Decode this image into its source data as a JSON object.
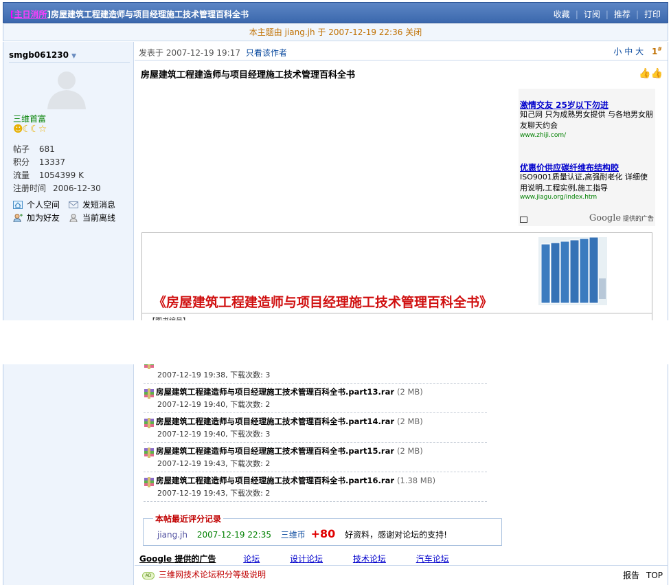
{
  "thread": {
    "tag_open": "[",
    "tag": "主日消所",
    "tag_close": "]",
    "title": "房屋建筑工程建造师与项目经理施工技术管理百科全书",
    "actions": [
      "收藏",
      "订阅",
      "推荐",
      "打印"
    ]
  },
  "closed_notice": "本主题由 jiang.jh 于  2007-12-19 22:36 关闭",
  "user": {
    "name": "smgb061230",
    "group": "三维首富",
    "stats": [
      {
        "key": "帖子",
        "val": "681"
      },
      {
        "key": "积分",
        "val": "13337"
      },
      {
        "key": "流量",
        "val": "1054399 K"
      },
      {
        "key": "注册时间",
        "val": "2006-12-30"
      }
    ],
    "actions": [
      "个人空间",
      "发短消息",
      "加为好友",
      "当前离线"
    ]
  },
  "post": {
    "posted_prefix": "发表于",
    "posted_at": "2007-12-19 19:17",
    "only_author": "只看该作者",
    "font_sizes": [
      "小",
      "中",
      "大"
    ],
    "floor": "1",
    "floor_mark": "#",
    "title": "房屋建筑工程建造师与项目经理施工技术管理百科全书",
    "book_title": "《房屋建筑工程建造师与项目经理施工技术管理百科全书》",
    "cut_text": "【图书编号】"
  },
  "ads": [
    {
      "title": "激情交友  25岁以下勿进",
      "desc": "知己网 只为成熟男女提供 与各地男女朋友聊天约会",
      "url": "www.zhiji.com/"
    },
    {
      "title": "优惠价供应碳纤维布结构胶",
      "desc": "ISO9001质量认证,高强耐老化 详细使用说明,工程实例,施工指导",
      "url": "www.jiagu.org/index.htm"
    }
  ],
  "ads_footer_brand": "Google",
  "ads_footer_text": "提供的广告",
  "attachments": [
    {
      "name": "",
      "size": "",
      "meta": "2007-12-19 19:38, 下载次数: 3"
    },
    {
      "name": "房屋建筑工程建造师与项目经理施工技术管理百科全书.part13.rar",
      "size": "(2 MB)",
      "meta": "2007-12-19 19:40, 下载次数: 2"
    },
    {
      "name": "房屋建筑工程建造师与项目经理施工技术管理百科全书.part14.rar",
      "size": "(2 MB)",
      "meta": "2007-12-19 19:40, 下载次数: 3"
    },
    {
      "name": "房屋建筑工程建造师与项目经理施工技术管理百科全书.part15.rar",
      "size": "(2 MB)",
      "meta": "2007-12-19 19:43, 下载次数: 2"
    },
    {
      "name": "房屋建筑工程建造师与项目经理施工技术管理百科全书.part16.rar",
      "size": "(1.38 MB)",
      "meta": "2007-12-19 19:43, 下载次数: 2"
    }
  ],
  "rating": {
    "caption": "本帖最近评分记录",
    "user": "jiang.jh",
    "date": "2007-12-19 22:35",
    "currency": "三维币",
    "points": "+80",
    "reason": "好资料，感谢对论坛的支持!"
  },
  "google_links": {
    "header": "Google 提供的广告",
    "links": [
      "论坛",
      "设计论坛",
      "技术论坛",
      "汽车论坛"
    ]
  },
  "footer": {
    "badge": "AD",
    "link": "三维网技术论坛积分等级说明",
    "report": "报告",
    "top": "TOP"
  }
}
